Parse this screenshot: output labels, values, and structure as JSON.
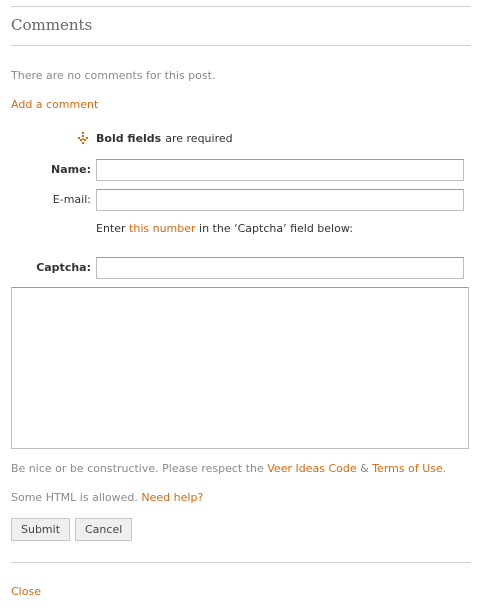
{
  "comments": {
    "heading": "Comments",
    "empty_text": "There are no comments for this post.",
    "add_link": "Add a comment"
  },
  "form": {
    "required_icon": "required-marker-icon",
    "required_bold": "Bold fields",
    "required_rest": "are required",
    "name_label": "Name:",
    "name_value": "",
    "email_label": "E-mail:",
    "email_value": "",
    "captcha_prefix": "Enter",
    "captcha_link": "this number",
    "captcha_suffix": "in the ‘Captcha’ field below:",
    "captcha_label": "Captcha:",
    "captcha_value": "",
    "comment_value": "",
    "notice_prefix": "Be nice or be constructive. Please respect the",
    "code_link": "Veer Ideas Code",
    "notice_amp": "&",
    "terms_link": "Terms of Use",
    "notice_end": ".",
    "html_text": "Some HTML is allowed.",
    "help_link": "Need help?",
    "submit_label": "Submit",
    "cancel_label": "Cancel",
    "close_link": "Close"
  },
  "colors": {
    "link": "#d46a12",
    "muted_text": "#8a8a8a",
    "rule": "#cfcfcf",
    "required_marker": "#d46a12"
  }
}
